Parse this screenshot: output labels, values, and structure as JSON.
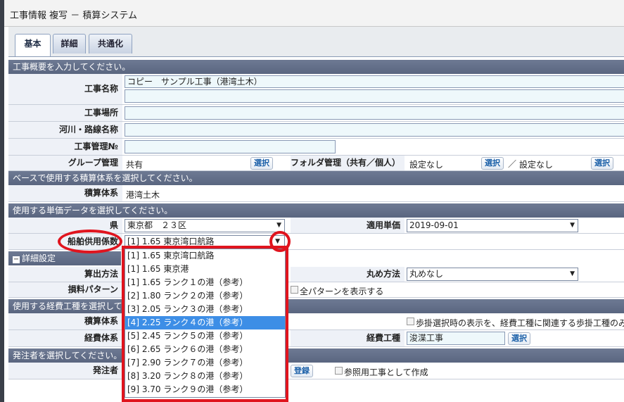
{
  "window": {
    "title": "工事情報 複写 － 積算システム"
  },
  "tabs": [
    {
      "label": "基本",
      "active": true
    },
    {
      "label": "詳細",
      "active": false
    },
    {
      "label": "共通化",
      "active": false
    }
  ],
  "sections": {
    "overview": "工事概要を入力してください。",
    "base_system": "ベースで使用する積算体系を選択してください。",
    "unit_price": "使用する単価データを選択してください。",
    "detail": "詳細設定",
    "expense": "使用する経費工種を選択して",
    "client": "発注者を選択してください。"
  },
  "fields": {
    "project_name": {
      "label": "工事名称",
      "value": "コピー　サンプル工事（港湾土木）"
    },
    "location": {
      "label": "工事場所",
      "value": ""
    },
    "river_route": {
      "label": "河川・路線名称",
      "value": ""
    },
    "project_no": {
      "label": "工事管理№",
      "value": ""
    },
    "group": {
      "label": "グループ管理",
      "value": "共有",
      "button": "選択"
    },
    "folder": {
      "label": "フォルダ管理（共有／個人）",
      "value1": "設定なし",
      "button1": "選択",
      "sep": "／",
      "value2": "設定なし",
      "button2": "選択"
    },
    "estimation_system": {
      "label": "積算体系",
      "value": "港湾土木"
    },
    "prefecture": {
      "label": "県",
      "value": "東京都　２３区"
    },
    "apply_price": {
      "label": "適用単価",
      "value": "2019-09-01"
    },
    "ship_coeff": {
      "label": "船舶供用係数",
      "value": "[1] 1.65 東京湾口航路"
    },
    "calc_method": {
      "label": "算出方法"
    },
    "rounding": {
      "label": "丸め方法",
      "value": "丸めなし"
    },
    "loss_pattern": {
      "label": "損料パターン",
      "checkbox": "全パターンを表示する"
    },
    "expense_system": {
      "label": "積算体系",
      "checkbox": "歩掛選択時の表示を、経費工種に関連する歩掛工種のみ"
    },
    "expense_class": {
      "label": "経費体系"
    },
    "expense_type": {
      "label": "経費工種",
      "value": "浚渫工事",
      "button": "選択"
    },
    "client": {
      "label": "発注者",
      "button": "登録",
      "checkbox": "参照用工事として作成"
    }
  },
  "dropdown_options": [
    "[1] 1.65 東京湾口航路",
    "[1] 1.65 東京港",
    "[1] 1.65 ランク１の港（参考）",
    "[2] 1.80 ランク２の港（参考）",
    "[3] 2.05 ランク３の港（参考）",
    "[4] 2.25 ランク４の港（参考）",
    "[5] 2.45 ランク５の港（参考）",
    "[6] 2.65 ランク６の港（参考）",
    "[7] 2.90 ランク７の港（参考）",
    "[8] 3.20 ランク８の港（参考）",
    "[9] 3.70 ランク９の港（参考）"
  ],
  "dropdown_selected_index": 5,
  "icons": {
    "dropdown_arrow": "▼",
    "collapse": "−"
  },
  "colors": {
    "highlight": "#e0141e",
    "selected": "#3d8ee6"
  }
}
